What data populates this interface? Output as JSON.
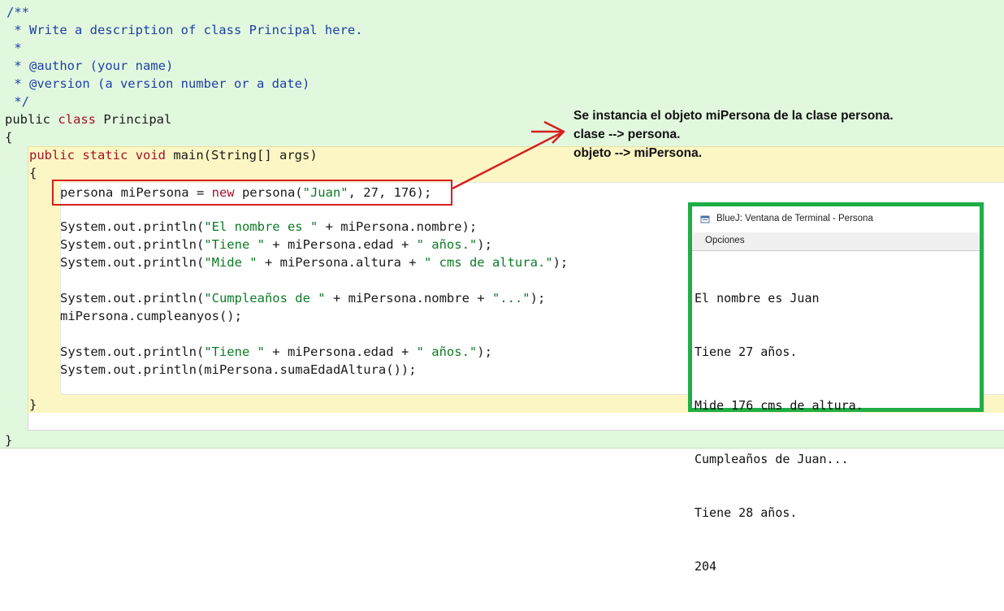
{
  "editor": {
    "comment_lines": [
      "/**",
      " * Write a description of class Principal here.",
      " *",
      " * @author (your name)",
      " * @version (a version number or a date)",
      " */"
    ],
    "class_decl": {
      "kw1": "public",
      "kw2": "class",
      "name": " Principal"
    },
    "open_brace_class": "{",
    "method_decl": {
      "kw1": "public",
      "kw2": "static",
      "kw3": "void",
      "rest": " main(String[] args)"
    },
    "open_brace_method": "{",
    "line_instance": {
      "pre": "persona miPersona = ",
      "kw": "new",
      "mid": " persona(",
      "str": "\"Juan\"",
      "post": ", 27, 176);"
    },
    "line_print1": {
      "pre": "System.out.println(",
      "str": "\"El nombre es \"",
      "post": " + miPersona.nombre);"
    },
    "line_print2": {
      "pre": "System.out.println(",
      "str1": "\"Tiene \"",
      "mid": " + miPersona.edad + ",
      "str2": "\" años.\"",
      "post": ");"
    },
    "line_print3": {
      "pre": "System.out.println(",
      "str1": "\"Mide \"",
      "mid": " + miPersona.altura + ",
      "str2": "\" cms de altura.\"",
      "post": ");"
    },
    "line_print4": {
      "pre": "System.out.println(",
      "str1": "\"Cumpleaños de \"",
      "mid": " + miPersona.nombre + ",
      "str2": "\"...\"",
      "post": ");"
    },
    "line_call": "miPersona.cumpleanyos();",
    "line_print5": {
      "pre": "System.out.println(",
      "str1": "\"Tiene \"",
      "mid": " + miPersona.edad + ",
      "str2": "\" años.\"",
      "post": ");"
    },
    "line_print6": "System.out.println(miPersona.sumaEdadAltura());",
    "close_brace_method": "}",
    "close_brace_class": "}"
  },
  "annotation": {
    "line1": "Se instancia el objeto miPersona de la clase persona.",
    "line2": "clase --> persona.",
    "line3": "objeto --> miPersona."
  },
  "terminal": {
    "title": "BlueJ: Ventana de Terminal - Persona",
    "menu": "Opciones",
    "output": [
      "El nombre es Juan",
      "Tiene 27 años.",
      "Mide 176 cms de altura.",
      "Cumpleaños de Juan...",
      "Tiene 28 años.",
      "204"
    ]
  },
  "colors": {
    "class_scope": "#e1f8de",
    "method_scope": "#fbf6c3",
    "highlight_box": "#d61f1f",
    "terminal_frame": "#1fae45"
  }
}
